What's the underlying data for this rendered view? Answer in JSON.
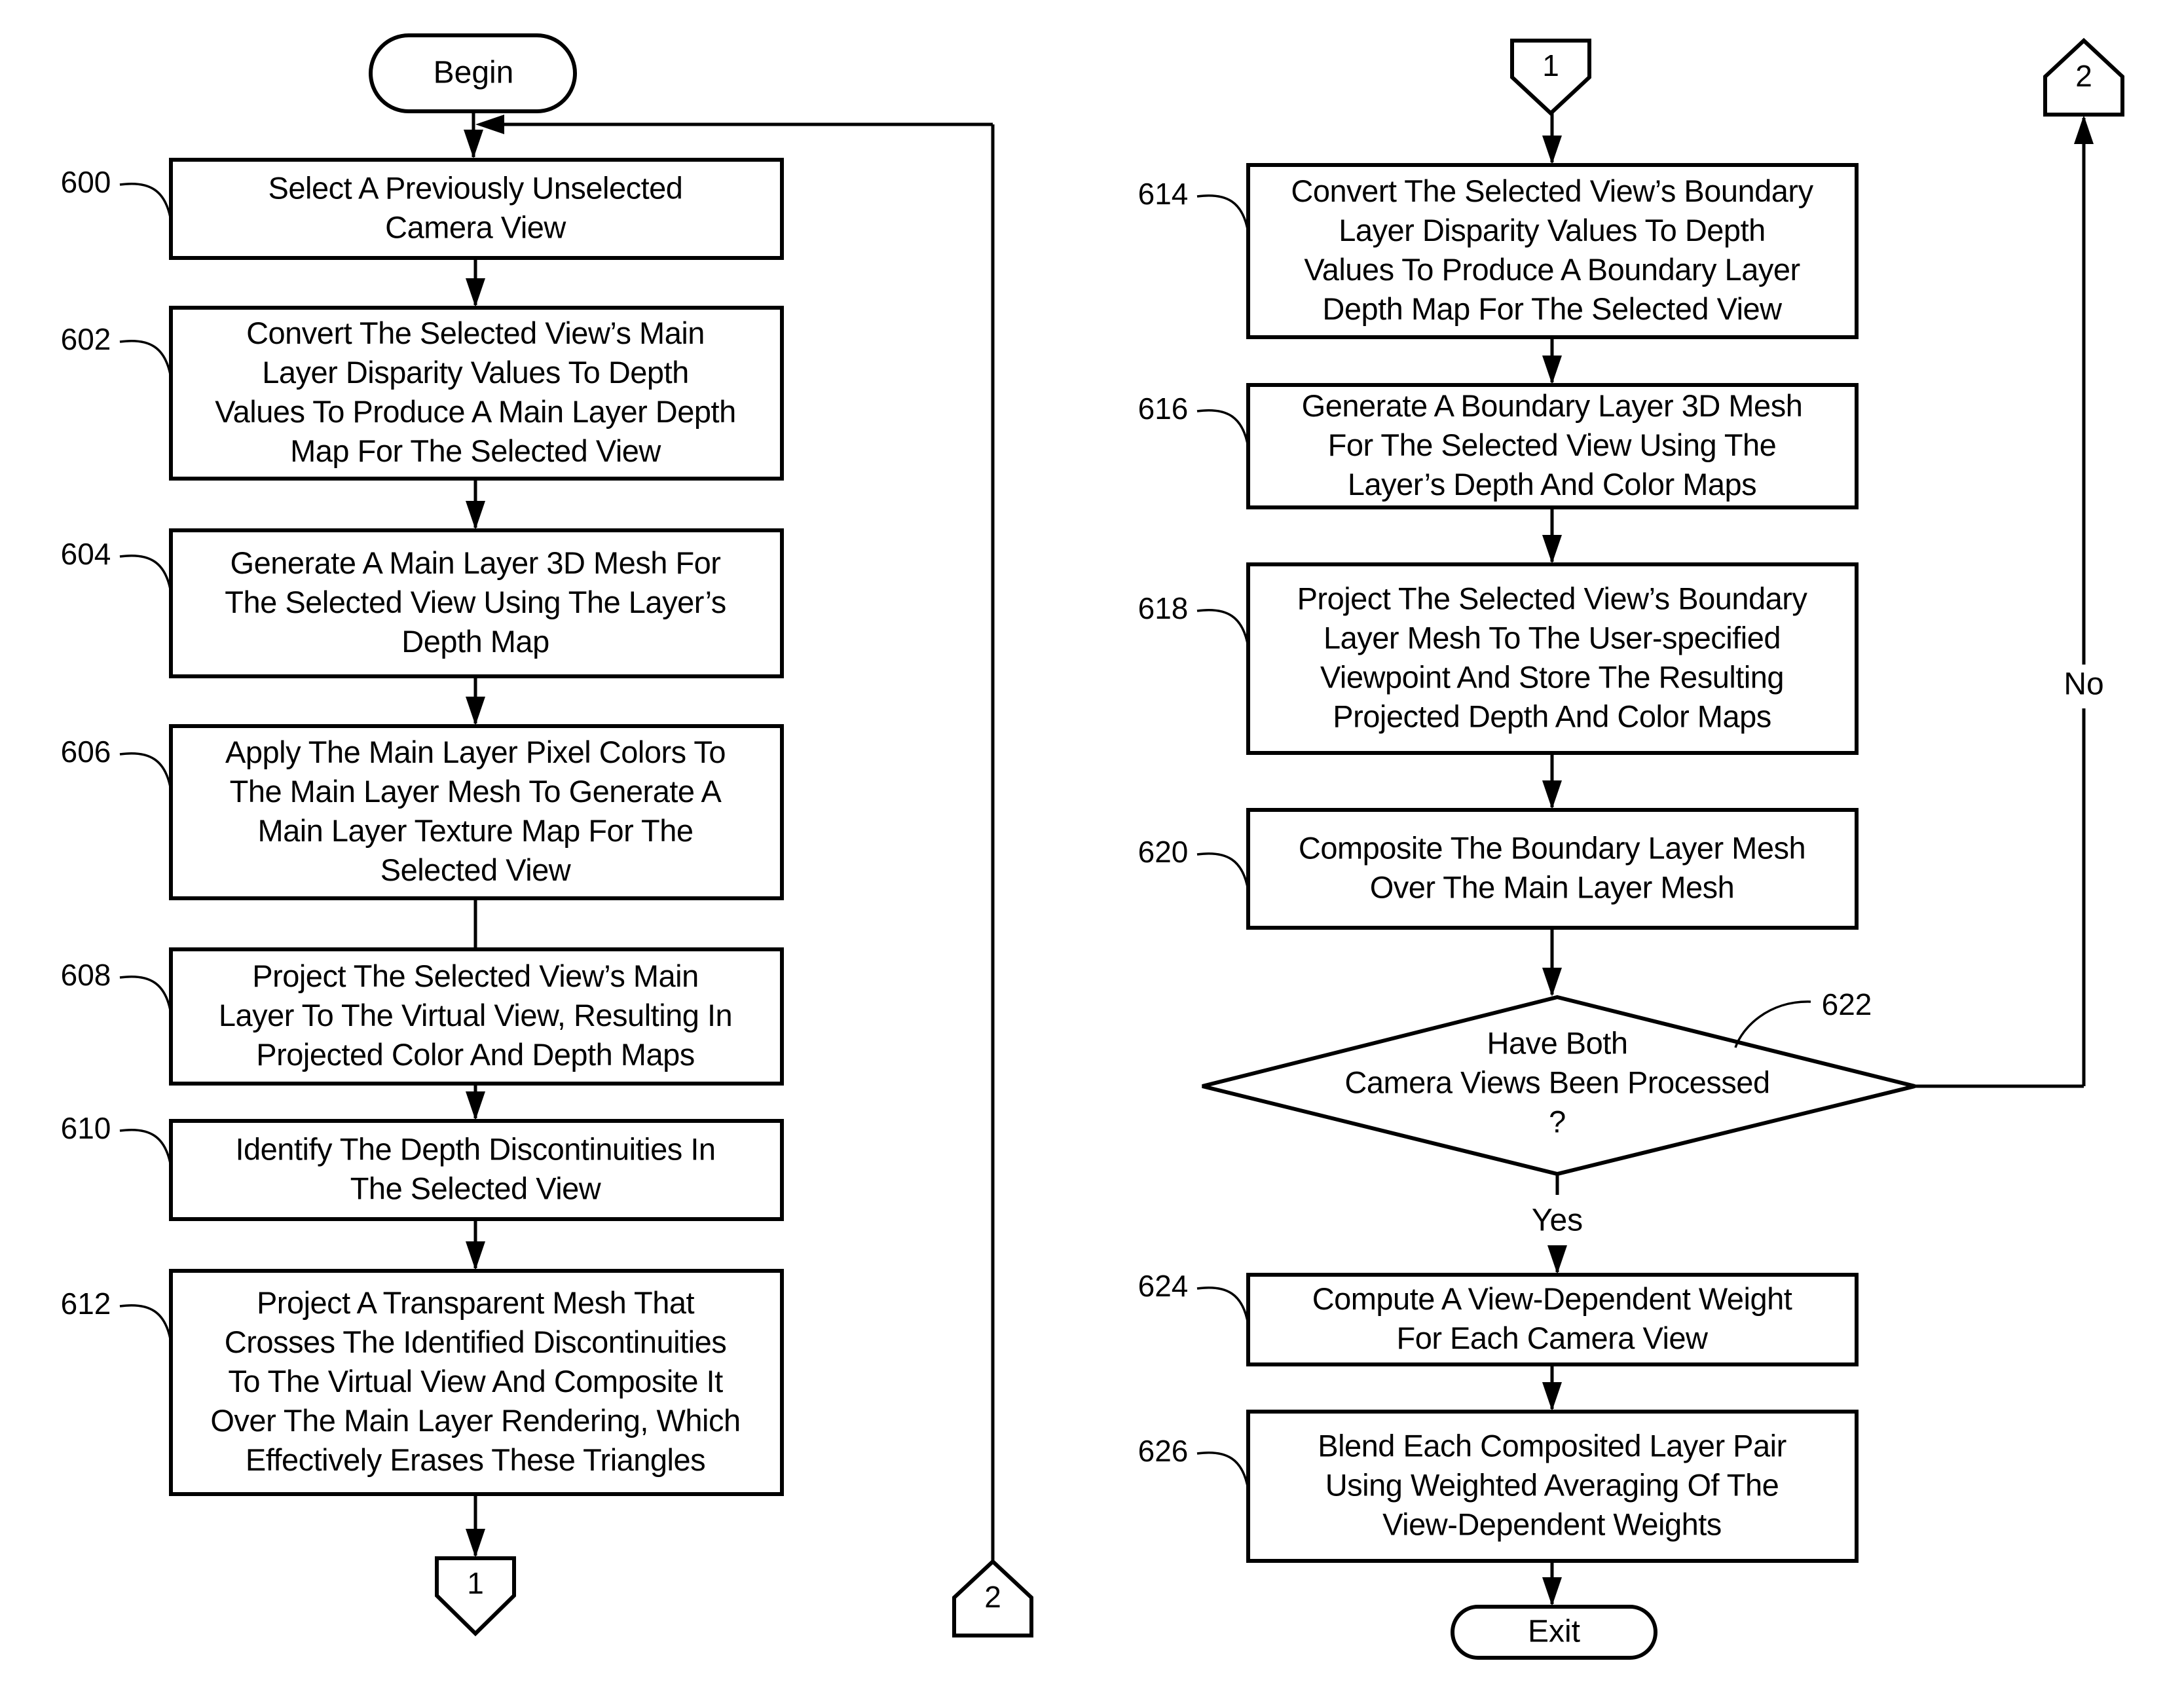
{
  "figure": {
    "type": "flowchart",
    "terminals": {
      "begin": "Begin",
      "exit": "Exit"
    },
    "steps": [
      {
        "ref": "600",
        "lines": [
          "Select A Previously Unselected",
          "Camera View"
        ]
      },
      {
        "ref": "602",
        "lines": [
          "Convert The Selected View’s Main",
          "Layer Disparity Values To Depth",
          "Values To Produce A Main Layer Depth",
          "Map For The  Selected View"
        ]
      },
      {
        "ref": "604",
        "lines": [
          "Generate A Main Layer 3D Mesh For",
          "The Selected View Using The Layer’s",
          "Depth Map"
        ]
      },
      {
        "ref": "606",
        "lines": [
          "Apply The Main Layer Pixel Colors To",
          "The Main Layer Mesh To Generate A",
          "Main Layer Texture Map For The",
          "Selected View"
        ]
      },
      {
        "ref": "608",
        "lines": [
          "Project The Selected View’s Main",
          "Layer To The Virtual View, Resulting In",
          "Projected Color And Depth Maps"
        ]
      },
      {
        "ref": "610",
        "lines": [
          "Identify The Depth Discontinuities In",
          "The Selected View"
        ]
      },
      {
        "ref": "612",
        "lines": [
          "Project A Transparent Mesh That",
          "Crosses The Identified Discontinuities",
          "To The Virtual View And Composite It",
          "Over The Main Layer Rendering, Which",
          "Effectively Erases These Triangles"
        ]
      },
      {
        "ref": "614",
        "lines": [
          "Convert The Selected View’s Boundary",
          "Layer Disparity Values To Depth",
          "Values To Produce A Boundary Layer",
          "Depth Map For The  Selected View"
        ]
      },
      {
        "ref": "616",
        "lines": [
          "Generate A Boundary Layer 3D Mesh",
          "For The Selected View Using The",
          "Layer’s Depth And Color Maps"
        ]
      },
      {
        "ref": "618",
        "lines": [
          "Project The Selected View’s Boundary",
          "Layer Mesh To The User-specified",
          "Viewpoint And Store The Resulting",
          "Projected Depth And Color Maps"
        ]
      },
      {
        "ref": "620",
        "lines": [
          "Composite The Boundary Layer Mesh",
          "Over The Main Layer Mesh"
        ]
      },
      {
        "ref": "624",
        "lines": [
          "Compute A View-Dependent Weight",
          "For Each Camera View"
        ]
      },
      {
        "ref": "626",
        "lines": [
          "Blend Each Composited Layer Pair",
          "Using Weighted Averaging Of The",
          "View-Dependent Weights"
        ]
      }
    ],
    "decision": {
      "ref": "622",
      "lines": [
        "Have Both",
        "Camera Views Been Processed",
        "?"
      ],
      "yes_label": "Yes",
      "no_label": "No"
    },
    "connectors": {
      "one": "1",
      "two": "2"
    }
  }
}
